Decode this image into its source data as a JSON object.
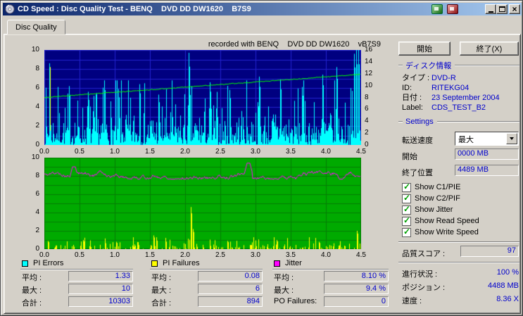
{
  "window": {
    "title": "CD Speed : Disc Quality Test - BENQ    DVD DD DW1620    B7S9"
  },
  "tab": {
    "label": "Disc Quality"
  },
  "chart_header": "recorded with BENQ    DVD DD DW1620    vB7S9",
  "actions": {
    "start": "開始",
    "exit": "終了(X)"
  },
  "disc_info": {
    "header": "ディスク情報",
    "fields": [
      {
        "label": "タイプ :",
        "value": "DVD-R"
      },
      {
        "label": "ID:",
        "value": "RITEKG04"
      },
      {
        "label": "日付 :",
        "value": "23 September 2004"
      },
      {
        "label": "Label:",
        "value": "CDS_TEST_B2"
      }
    ]
  },
  "settings": {
    "header": "Settings",
    "transfer_rate_label": "転送速度",
    "transfer_rate_value": "最大",
    "start_label": "開始",
    "start_value": "0000 MB",
    "end_label": "終了位置",
    "end_value": "4489 MB",
    "checkboxes": [
      {
        "label": "Show C1/PIE",
        "checked": true
      },
      {
        "label": "Show C2/PIF",
        "checked": true
      },
      {
        "label": "Show Jitter",
        "checked": true
      },
      {
        "label": "Show Read Speed",
        "checked": true
      },
      {
        "label": "Show Write Speed",
        "checked": true
      }
    ]
  },
  "quality_score": {
    "label": "品質スコア :",
    "value": "97"
  },
  "status": {
    "rows": [
      {
        "label": "進行状況 :",
        "value": "100 %"
      },
      {
        "label": "ポジション :",
        "value": "4488 MB"
      },
      {
        "label": "速度 :",
        "value": "8.36 X"
      }
    ]
  },
  "legend": [
    {
      "title": "PI Errors",
      "color": "#00ffff",
      "rows": [
        {
          "label": "平均 :",
          "value": "1.33"
        },
        {
          "label": "最大 :",
          "value": "10"
        },
        {
          "label": "合計 :",
          "value": "10303"
        }
      ]
    },
    {
      "title": "PI Failures",
      "color": "#ffff00",
      "rows": [
        {
          "label": "平均 :",
          "value": "0.08"
        },
        {
          "label": "最大 :",
          "value": "6"
        },
        {
          "label": "合計 :",
          "value": "894"
        }
      ]
    },
    {
      "title": "Jitter",
      "color": "#ff00ff",
      "rows": [
        {
          "label": "平均 :",
          "value": "8.10 %"
        },
        {
          "label": "最大 :",
          "value": "9.4 %"
        },
        {
          "label": "PO Failures:",
          "value": "0"
        }
      ]
    }
  ],
  "chart_data": [
    {
      "name": "PI Errors / Read Speed",
      "type": "area",
      "title": "recorded with BENQ DVD DD DW1620 vB7S9",
      "background": "#000080",
      "grid_color": "#2222cc",
      "grid": true,
      "x_axis": {
        "min": 0,
        "max": 4.5,
        "divisions": 9,
        "ticks": [
          "0.0",
          "0.5",
          "1.0",
          "1.5",
          "2.0",
          "2.5",
          "3.0",
          "3.5",
          "4.0",
          "4.5"
        ]
      },
      "y_left": {
        "min": 0,
        "max": 10,
        "divisions": 10,
        "ticks": [
          10,
          8,
          6,
          4,
          2,
          0
        ]
      },
      "y_right": {
        "min": 0,
        "max": 16,
        "ticks": [
          16,
          14,
          12,
          10,
          8,
          6,
          4,
          2,
          0
        ]
      },
      "series": [
        {
          "name": "PI Errors",
          "style": "spikes",
          "axis": "left",
          "color": "#00ffff",
          "seed": 7,
          "base_scale": 1.6,
          "minor_cap": 6.8,
          "density": 1,
          "avg": 1.33,
          "max": 10,
          "total": 10303,
          "peaks": [
            [
              0.07,
              8.6
            ],
            [
              0.35,
              6.2
            ],
            [
              0.62,
              5.6
            ],
            [
              0.85,
              6.8
            ],
            [
              1.05,
              5.9
            ],
            [
              1.35,
              6.4
            ],
            [
              1.62,
              5.3
            ],
            [
              2.05,
              9.7
            ],
            [
              2.35,
              6.6
            ],
            [
              2.63,
              5.8
            ],
            [
              3.05,
              7.2
            ],
            [
              3.35,
              6.9
            ],
            [
              3.66,
              6.1
            ],
            [
              3.95,
              7.4
            ],
            [
              4.15,
              8.2
            ],
            [
              4.4,
              9.6
            ],
            [
              4.43,
              10
            ],
            [
              4.46,
              10
            ]
          ]
        },
        {
          "name": "Start artifact",
          "style": "vsegment",
          "axis": "left",
          "color": "#ffff00",
          "x": 0.08,
          "from": 1.5,
          "to": 8.2
        },
        {
          "name": "Read Speed",
          "style": "line",
          "axis": "right",
          "color": "#00ff00",
          "seed": 3,
          "start": 8.0,
          "end": 11.9,
          "noise": 0.15,
          "avg_speed_x": 8.36
        }
      ]
    },
    {
      "name": "PI Failures / Jitter",
      "type": "area",
      "background": "#00aa00",
      "grid_color": "#067d06",
      "grid": true,
      "x_axis": {
        "min": 0,
        "max": 4.5,
        "divisions": 9,
        "ticks": [
          "0.0",
          "0.5",
          "1.0",
          "1.5",
          "2.0",
          "2.5",
          "3.0",
          "3.5",
          "4.0",
          "4.5"
        ]
      },
      "y_left": {
        "min": 0,
        "max": 10,
        "divisions": 10,
        "ticks": [
          10,
          8,
          6,
          4,
          2,
          0
        ]
      },
      "series": [
        {
          "name": "PI Failures",
          "style": "spikes",
          "axis": "left",
          "color": "#ffff00",
          "seed": 11,
          "base_scale": 0.45,
          "minor_cap": 1.3,
          "density": 0.38,
          "avg": 0.08,
          "max": 6,
          "total": 894,
          "peaks": [
            [
              0.05,
              0.9
            ],
            [
              0.55,
              1.0
            ],
            [
              1.02,
              0.8
            ],
            [
              1.55,
              1.5
            ],
            [
              2.08,
              4.6
            ],
            [
              2.11,
              2.2
            ],
            [
              2.6,
              0.9
            ],
            [
              3.3,
              1.0
            ],
            [
              3.9,
              0.8
            ],
            [
              4.44,
              2.0
            ]
          ]
        },
        {
          "name": "Jitter",
          "style": "noisy_line",
          "axis": "left",
          "color": "#ff00ff",
          "seed": 5,
          "base": 8.1,
          "noise": 0.45,
          "avg": 8.1,
          "max": 9.4,
          "peaks": [
            [
              0.42,
              9.0
            ],
            [
              2.9,
              9.4
            ]
          ]
        }
      ]
    }
  ]
}
